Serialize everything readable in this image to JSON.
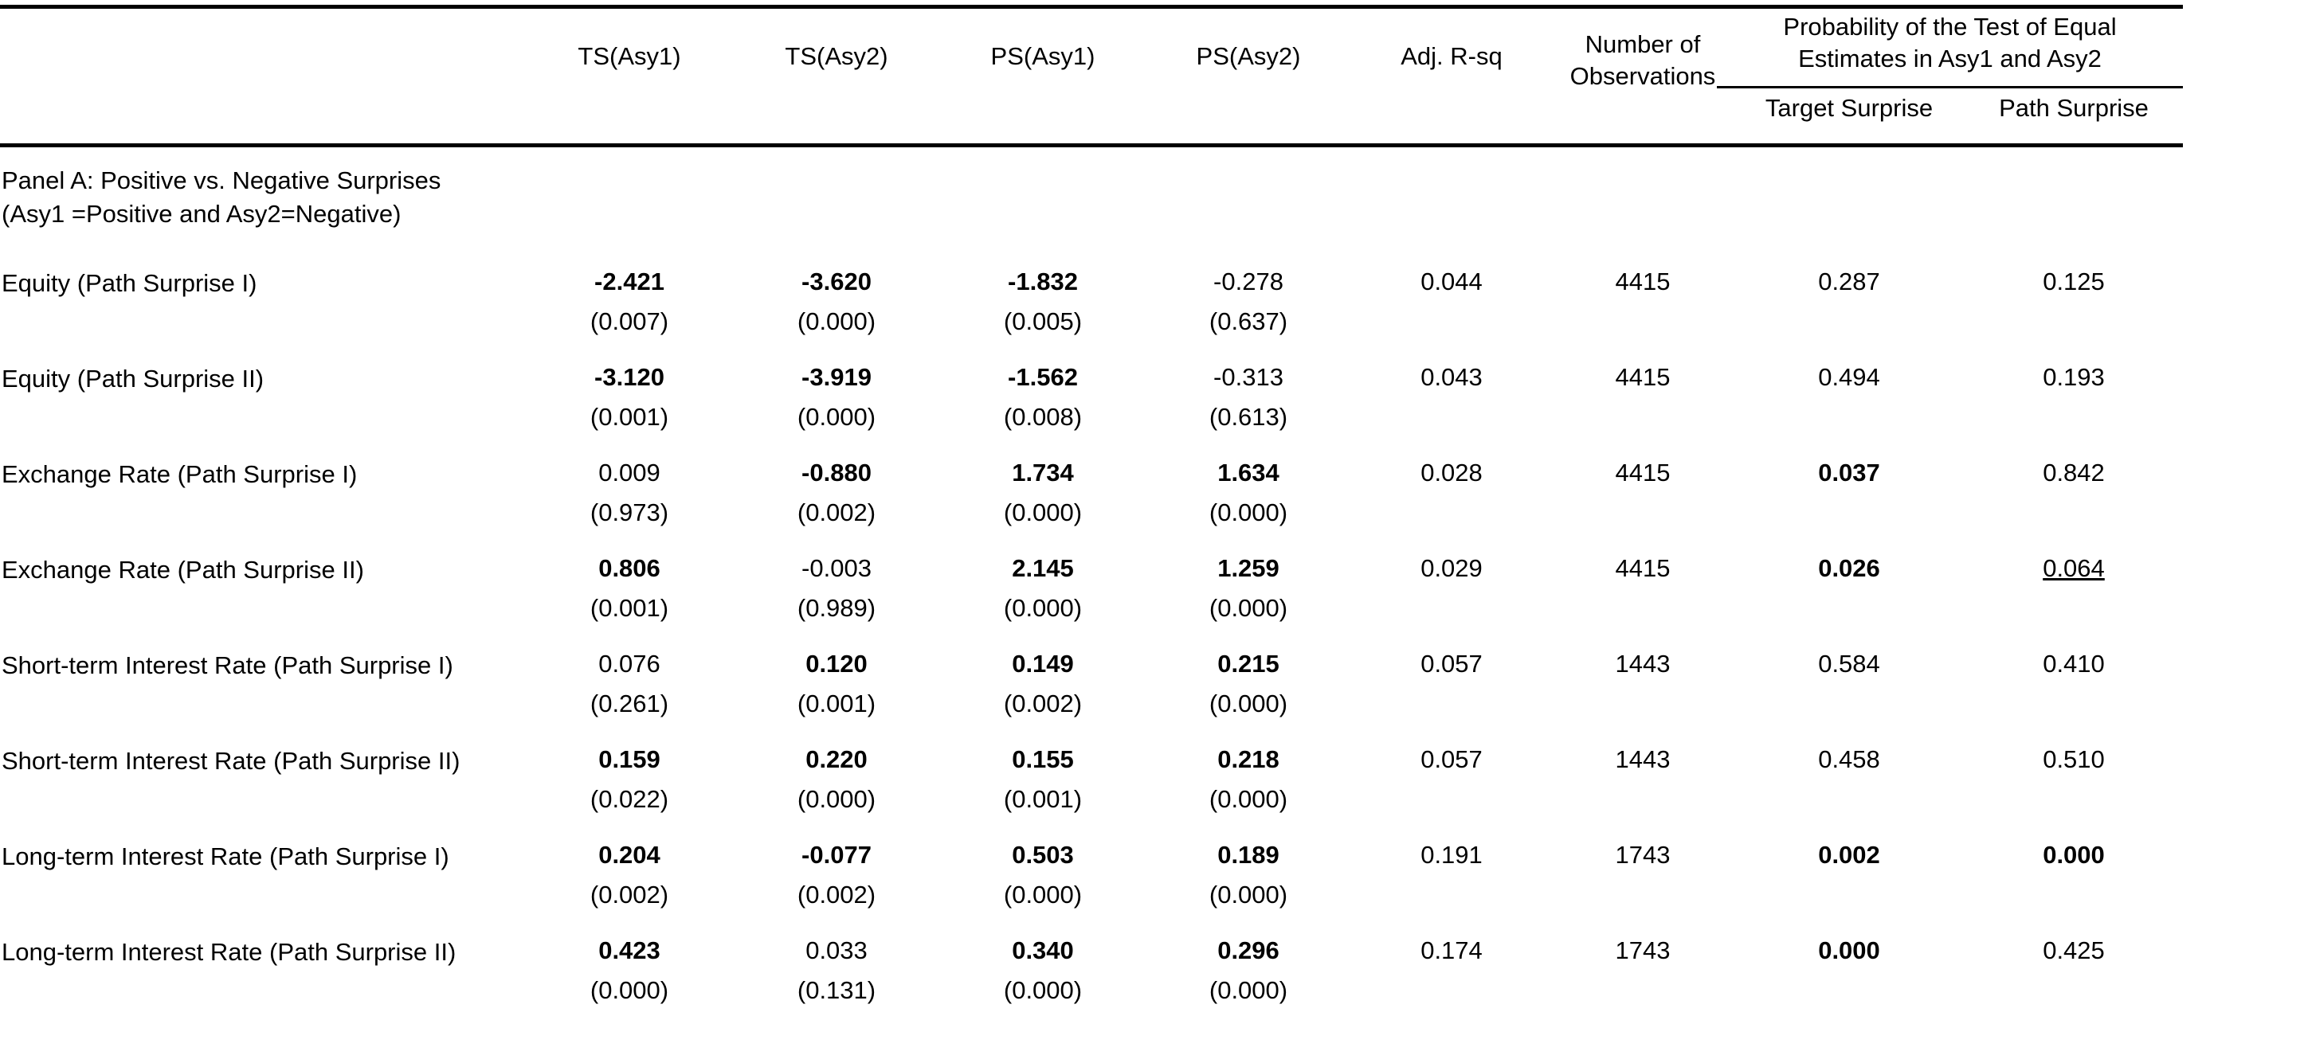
{
  "table": {
    "columns": [
      {
        "key": "label",
        "label": ""
      },
      {
        "key": "ts1",
        "label": "TS(Asy1)"
      },
      {
        "key": "ts2",
        "label": "TS(Asy2)"
      },
      {
        "key": "ps1",
        "label": "PS(Asy1)"
      },
      {
        "key": "ps2",
        "label": "PS(Asy2)"
      },
      {
        "key": "rsq",
        "label": "Adj. R-sq"
      },
      {
        "key": "nobs",
        "label_line1": "Number of",
        "label_line2": "Observations"
      }
    ],
    "spanning_header": {
      "title_line1": "Probability of the Test of Equal",
      "title_line2": "Estimates in  Asy1 and Asy2",
      "sub_columns": [
        {
          "key": "tsurp",
          "label": "Target Surprise"
        },
        {
          "key": "psurp",
          "label": "Path Surprise"
        }
      ]
    },
    "panel": {
      "title_line1": "Panel A: Positive vs. Negative Surprises",
      "title_line2": "(Asy1 =Positive and Asy2=Negative)"
    },
    "rows": [
      {
        "label": "Equity (Path Surprise I)",
        "ts1": {
          "coef": "-2.421",
          "bold": true,
          "p": "(0.007)"
        },
        "ts2": {
          "coef": "-3.620",
          "bold": true,
          "p": "(0.000)"
        },
        "ps1": {
          "coef": "-1.832",
          "bold": true,
          "p": "(0.005)"
        },
        "ps2": {
          "coef": "-0.278",
          "bold": false,
          "p": "(0.637)"
        },
        "rsq": {
          "value": "0.044",
          "bold": false
        },
        "nobs": {
          "value": "4415",
          "bold": false
        },
        "tsurp": {
          "value": "0.287",
          "bold": false,
          "underline": false
        },
        "psurp": {
          "value": "0.125",
          "bold": false,
          "underline": false
        }
      },
      {
        "label": "Equity (Path Surprise II)",
        "ts1": {
          "coef": "-3.120",
          "bold": true,
          "p": "(0.001)"
        },
        "ts2": {
          "coef": "-3.919",
          "bold": true,
          "p": "(0.000)"
        },
        "ps1": {
          "coef": "-1.562",
          "bold": true,
          "p": "(0.008)"
        },
        "ps2": {
          "coef": "-0.313",
          "bold": false,
          "p": "(0.613)"
        },
        "rsq": {
          "value": "0.043",
          "bold": false
        },
        "nobs": {
          "value": "4415",
          "bold": false
        },
        "tsurp": {
          "value": "0.494",
          "bold": false,
          "underline": false
        },
        "psurp": {
          "value": "0.193",
          "bold": false,
          "underline": false
        }
      },
      {
        "label": "Exchange Rate (Path Surprise I)",
        "ts1": {
          "coef": "0.009",
          "bold": false,
          "p": "(0.973)"
        },
        "ts2": {
          "coef": "-0.880",
          "bold": true,
          "p": "(0.002)"
        },
        "ps1": {
          "coef": "1.734",
          "bold": true,
          "p": "(0.000)"
        },
        "ps2": {
          "coef": "1.634",
          "bold": true,
          "p": "(0.000)"
        },
        "rsq": {
          "value": "0.028",
          "bold": false
        },
        "nobs": {
          "value": "4415",
          "bold": false
        },
        "tsurp": {
          "value": "0.037",
          "bold": true,
          "underline": false
        },
        "psurp": {
          "value": "0.842",
          "bold": false,
          "underline": false
        }
      },
      {
        "label": "Exchange Rate (Path Surprise II)",
        "ts1": {
          "coef": "0.806",
          "bold": true,
          "p": "(0.001)"
        },
        "ts2": {
          "coef": "-0.003",
          "bold": false,
          "p": "(0.989)"
        },
        "ps1": {
          "coef": "2.145",
          "bold": true,
          "p": "(0.000)"
        },
        "ps2": {
          "coef": "1.259",
          "bold": true,
          "p": "(0.000)"
        },
        "rsq": {
          "value": "0.029",
          "bold": false
        },
        "nobs": {
          "value": "4415",
          "bold": false
        },
        "tsurp": {
          "value": "0.026",
          "bold": true,
          "underline": false
        },
        "psurp": {
          "value": "0.064",
          "bold": false,
          "underline": true
        }
      },
      {
        "label": "Short-term Interest Rate (Path Surprise I)",
        "ts1": {
          "coef": "0.076",
          "bold": false,
          "p": "(0.261)"
        },
        "ts2": {
          "coef": "0.120",
          "bold": true,
          "p": "(0.001)"
        },
        "ps1": {
          "coef": "0.149",
          "bold": true,
          "p": "(0.002)"
        },
        "ps2": {
          "coef": "0.215",
          "bold": true,
          "p": "(0.000)"
        },
        "rsq": {
          "value": "0.057",
          "bold": false
        },
        "nobs": {
          "value": "1443",
          "bold": false
        },
        "tsurp": {
          "value": "0.584",
          "bold": false,
          "underline": false
        },
        "psurp": {
          "value": "0.410",
          "bold": false,
          "underline": false
        }
      },
      {
        "label": "Short-term Interest Rate (Path Surprise II)",
        "ts1": {
          "coef": "0.159",
          "bold": true,
          "p": "(0.022)"
        },
        "ts2": {
          "coef": "0.220",
          "bold": true,
          "p": "(0.000)"
        },
        "ps1": {
          "coef": "0.155",
          "bold": true,
          "p": "(0.001)"
        },
        "ps2": {
          "coef": "0.218",
          "bold": true,
          "p": "(0.000)"
        },
        "rsq": {
          "value": "0.057",
          "bold": false
        },
        "nobs": {
          "value": "1443",
          "bold": false
        },
        "tsurp": {
          "value": "0.458",
          "bold": false,
          "underline": false
        },
        "psurp": {
          "value": "0.510",
          "bold": false,
          "underline": false
        }
      },
      {
        "label": "Long-term Interest Rate (Path Surprise I)",
        "ts1": {
          "coef": "0.204",
          "bold": true,
          "p": "(0.002)"
        },
        "ts2": {
          "coef": "-0.077",
          "bold": true,
          "p": "(0.002)"
        },
        "ps1": {
          "coef": "0.503",
          "bold": true,
          "p": "(0.000)"
        },
        "ps2": {
          "coef": "0.189",
          "bold": true,
          "p": "(0.000)"
        },
        "rsq": {
          "value": "0.191",
          "bold": false
        },
        "nobs": {
          "value": "1743",
          "bold": false
        },
        "tsurp": {
          "value": "0.002",
          "bold": true,
          "underline": false
        },
        "psurp": {
          "value": "0.000",
          "bold": true,
          "underline": false
        }
      },
      {
        "label": "Long-term Interest Rate (Path Surprise II)",
        "ts1": {
          "coef": "0.423",
          "bold": true,
          "p": "(0.000)"
        },
        "ts2": {
          "coef": "0.033",
          "bold": false,
          "p": "(0.131)"
        },
        "ps1": {
          "coef": "0.340",
          "bold": true,
          "p": "(0.000)"
        },
        "ps2": {
          "coef": "0.296",
          "bold": true,
          "p": "(0.000)"
        },
        "rsq": {
          "value": "0.174",
          "bold": false
        },
        "nobs": {
          "value": "1743",
          "bold": false
        },
        "tsurp": {
          "value": "0.000",
          "bold": true,
          "underline": false
        },
        "psurp": {
          "value": "0.425",
          "bold": false,
          "underline": false
        }
      }
    ]
  }
}
